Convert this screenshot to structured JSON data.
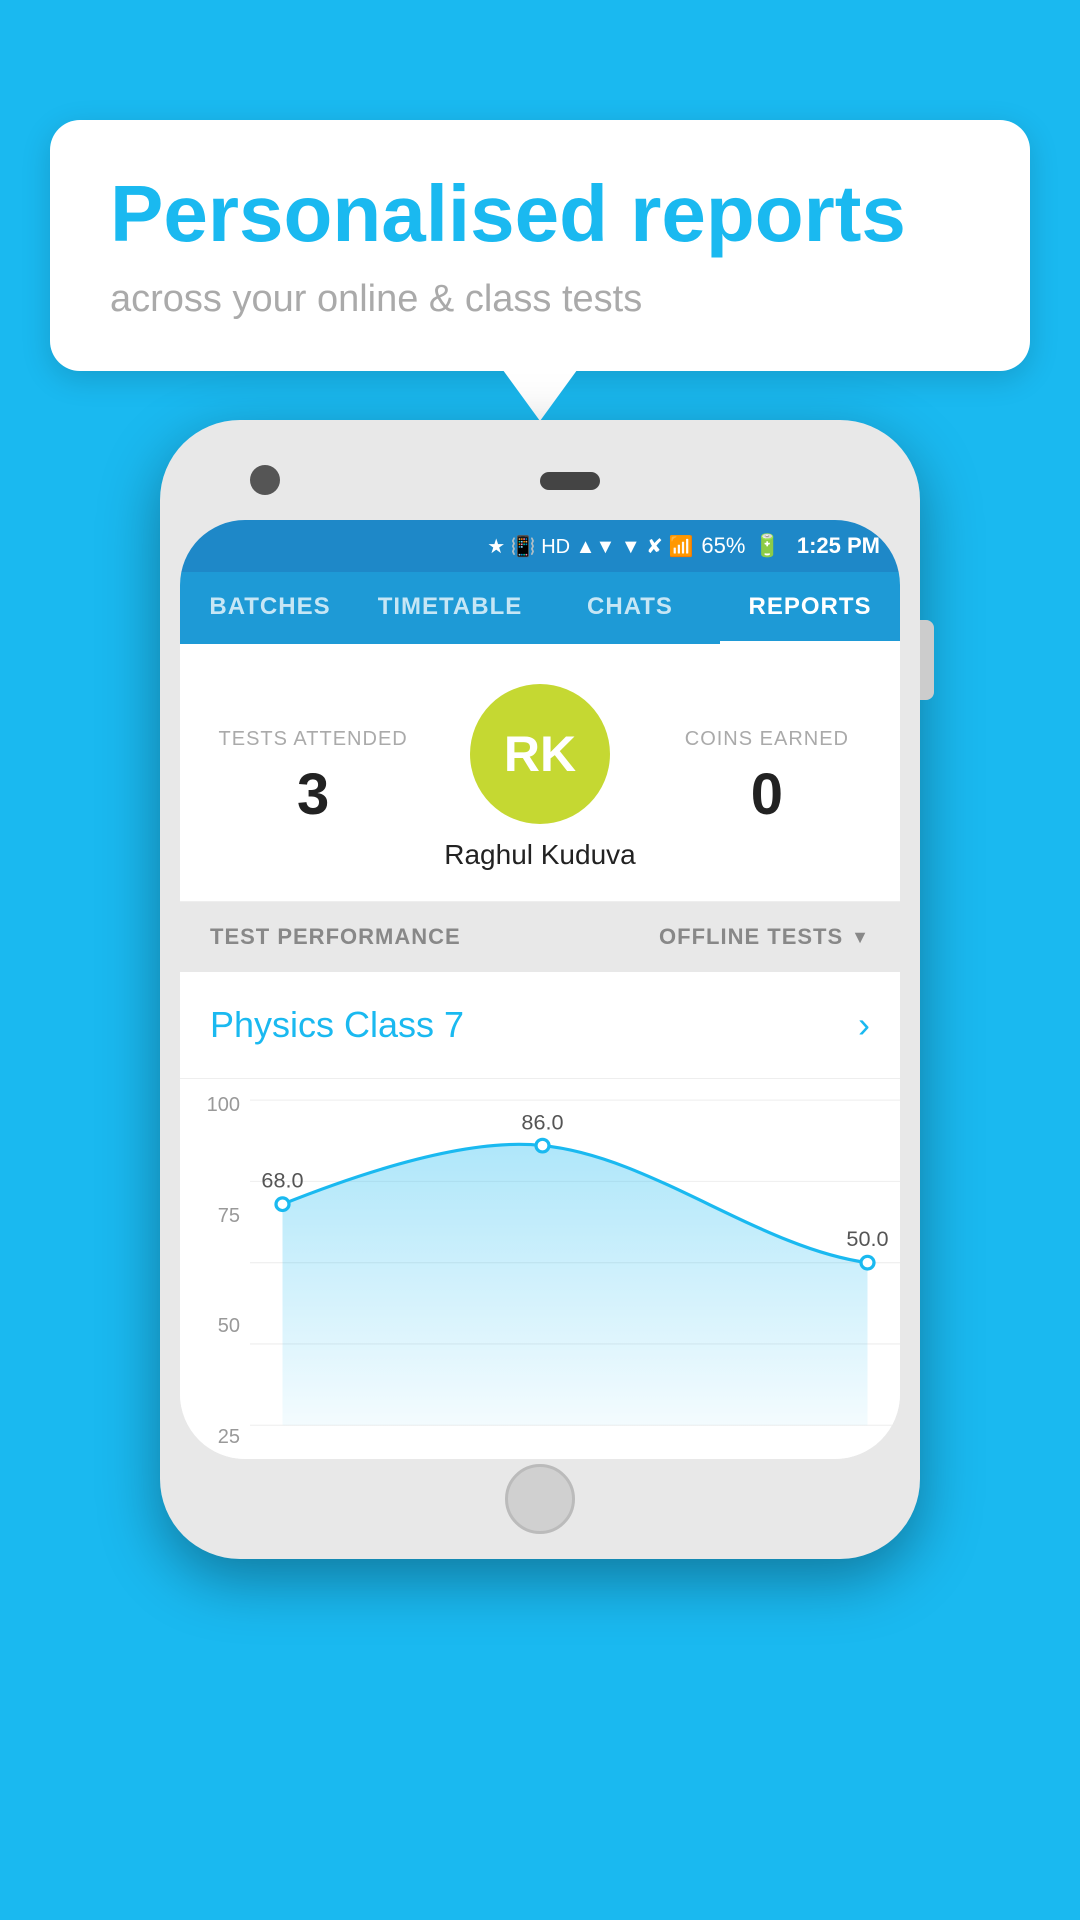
{
  "background_color": "#1ab9f0",
  "bubble": {
    "title": "Personalised reports",
    "subtitle": "across your online & class tests"
  },
  "status_bar": {
    "battery": "65%",
    "time": "1:25 PM",
    "icons": "🔵 📳 HD ▲ ▼ 📶 ✕ 📶"
  },
  "nav": {
    "tabs": [
      {
        "label": "BATCHES",
        "active": false
      },
      {
        "label": "TIMETABLE",
        "active": false
      },
      {
        "label": "CHATS",
        "active": false
      },
      {
        "label": "REPORTS",
        "active": true
      }
    ]
  },
  "user": {
    "avatar_initials": "RK",
    "name": "Raghul Kuduva",
    "tests_attended_label": "TESTS ATTENDED",
    "tests_attended_value": "3",
    "coins_earned_label": "COINS EARNED",
    "coins_earned_value": "0"
  },
  "performance": {
    "section_label": "TEST PERFORMANCE",
    "filter_label": "OFFLINE TESTS",
    "class_name": "Physics Class 7",
    "chart": {
      "y_labels": [
        "100",
        "75",
        "50",
        "25"
      ],
      "data_points": [
        {
          "label": "",
          "value": 68.0,
          "x_pct": 5
        },
        {
          "label": "",
          "value": 86.0,
          "x_pct": 45
        },
        {
          "label": "",
          "value": 50.0,
          "x_pct": 95
        }
      ],
      "point_labels": [
        "68.0",
        "86.0",
        "50.0"
      ]
    }
  }
}
